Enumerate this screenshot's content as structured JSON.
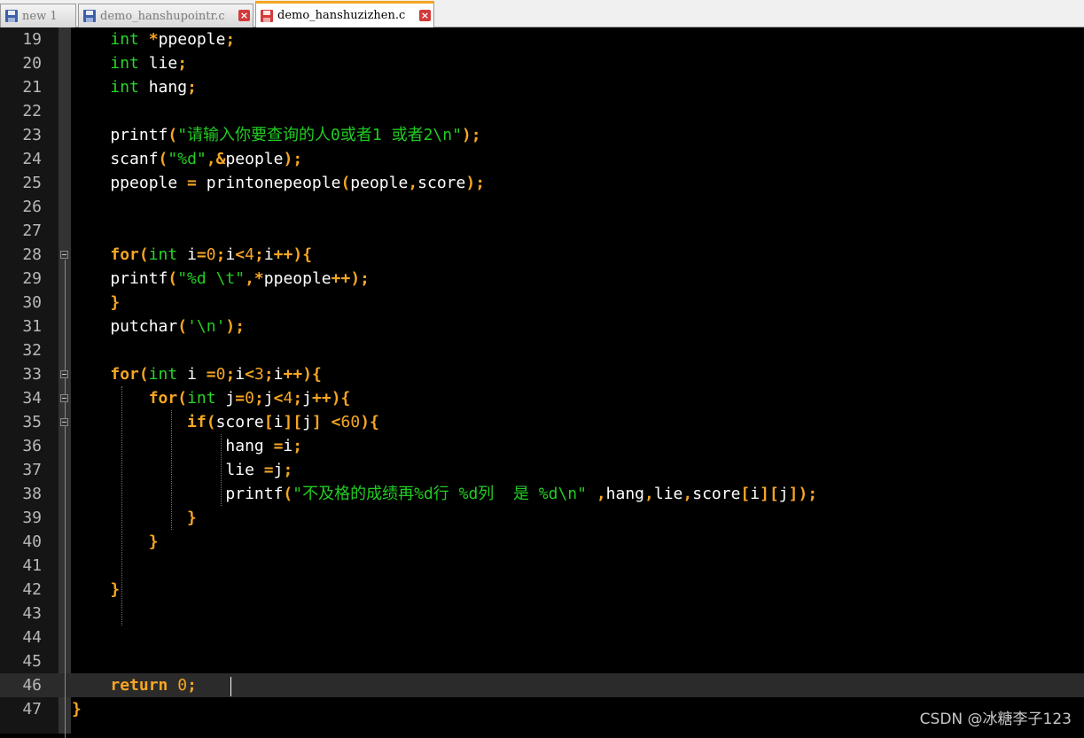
{
  "tabs": [
    {
      "label": "new 1",
      "icon": "floppy-disk-icon",
      "active": false
    },
    {
      "label": "demo_hanshupointr.c",
      "icon": "floppy-disk-icon",
      "active": false
    },
    {
      "label": "demo_hanshuzizhen.c",
      "icon": "floppy-disk-red-icon",
      "active": true
    }
  ],
  "colors": {
    "keyword": "#f5a623",
    "type": "#27d627",
    "string": "#22cc22",
    "number": "#f5a623",
    "text": "#ffffff",
    "background": "#000000",
    "gutter": "#151515",
    "current_line": "#2b2b2b",
    "tab_accent": "#f5a623"
  },
  "editor": {
    "current_line": 46,
    "lines": [
      {
        "num": "19",
        "tokens": [
          [
            "    ",
            ""
          ],
          [
            "int",
            "ty"
          ],
          [
            " ",
            ""
          ],
          [
            "*",
            "op"
          ],
          [
            "ppeople",
            ""
          ],
          [
            ";",
            "op"
          ]
        ]
      },
      {
        "num": "20",
        "tokens": [
          [
            "    ",
            ""
          ],
          [
            "int",
            "ty"
          ],
          [
            " lie",
            ""
          ],
          [
            ";",
            "op"
          ]
        ]
      },
      {
        "num": "21",
        "tokens": [
          [
            "    ",
            ""
          ],
          [
            "int",
            "ty"
          ],
          [
            " hang",
            ""
          ],
          [
            ";",
            "op"
          ]
        ]
      },
      {
        "num": "22",
        "tokens": []
      },
      {
        "num": "23",
        "tokens": [
          [
            "    printf",
            ""
          ],
          [
            "(",
            "op"
          ],
          [
            "\"请输入你要查询的人0或者1 或者2\\n\"",
            "str"
          ],
          [
            ")",
            "op"
          ],
          [
            ";",
            "op"
          ]
        ]
      },
      {
        "num": "24",
        "tokens": [
          [
            "    scanf",
            ""
          ],
          [
            "(",
            "op"
          ],
          [
            "\"%d\"",
            "str"
          ],
          [
            ",",
            "op"
          ],
          [
            "&",
            "op"
          ],
          [
            "people",
            ""
          ],
          [
            ")",
            "op"
          ],
          [
            ";",
            "op"
          ]
        ]
      },
      {
        "num": "25",
        "tokens": [
          [
            "    ppeople ",
            ""
          ],
          [
            "=",
            "op"
          ],
          [
            " printonepeople",
            ""
          ],
          [
            "(",
            "op"
          ],
          [
            "people",
            ""
          ],
          [
            ",",
            "op"
          ],
          [
            "score",
            ""
          ],
          [
            ")",
            "op"
          ],
          [
            ";",
            "op"
          ]
        ]
      },
      {
        "num": "26",
        "tokens": []
      },
      {
        "num": "27",
        "tokens": []
      },
      {
        "num": "28",
        "tokens": [
          [
            "    ",
            ""
          ],
          [
            "for",
            "kw"
          ],
          [
            "(",
            "op"
          ],
          [
            "int",
            "ty"
          ],
          [
            " i",
            ""
          ],
          [
            "=",
            "op"
          ],
          [
            "0",
            "num"
          ],
          [
            ";",
            "op"
          ],
          [
            "i",
            ""
          ],
          [
            "<",
            "op"
          ],
          [
            "4",
            "num"
          ],
          [
            ";",
            "op"
          ],
          [
            "i",
            ""
          ],
          [
            "++",
            "op"
          ],
          [
            ")",
            "op"
          ],
          [
            "{",
            "op"
          ]
        ]
      },
      {
        "num": "29",
        "tokens": [
          [
            "    printf",
            ""
          ],
          [
            "(",
            "op"
          ],
          [
            "\"%d \\t\"",
            "str"
          ],
          [
            ",",
            "op"
          ],
          [
            "*",
            "op"
          ],
          [
            "ppeople",
            ""
          ],
          [
            "++",
            "op"
          ],
          [
            ")",
            "op"
          ],
          [
            ";",
            "op"
          ]
        ]
      },
      {
        "num": "30",
        "tokens": [
          [
            "    ",
            ""
          ],
          [
            "}",
            "op"
          ]
        ]
      },
      {
        "num": "31",
        "tokens": [
          [
            "    putchar",
            ""
          ],
          [
            "(",
            "op"
          ],
          [
            "'\\n'",
            "str"
          ],
          [
            ")",
            "op"
          ],
          [
            ";",
            "op"
          ]
        ]
      },
      {
        "num": "32",
        "tokens": []
      },
      {
        "num": "33",
        "tokens": [
          [
            "    ",
            ""
          ],
          [
            "for",
            "kw"
          ],
          [
            "(",
            "op"
          ],
          [
            "int",
            "ty"
          ],
          [
            " i ",
            ""
          ],
          [
            "=",
            "op"
          ],
          [
            "0",
            "num"
          ],
          [
            ";",
            "op"
          ],
          [
            "i",
            ""
          ],
          [
            "<",
            "op"
          ],
          [
            "3",
            "num"
          ],
          [
            ";",
            "op"
          ],
          [
            "i",
            ""
          ],
          [
            "++",
            "op"
          ],
          [
            ")",
            "op"
          ],
          [
            "{",
            "op"
          ]
        ]
      },
      {
        "num": "34",
        "tokens": [
          [
            "        ",
            ""
          ],
          [
            "for",
            "kw"
          ],
          [
            "(",
            "op"
          ],
          [
            "int",
            "ty"
          ],
          [
            " j",
            ""
          ],
          [
            "=",
            "op"
          ],
          [
            "0",
            "num"
          ],
          [
            ";",
            "op"
          ],
          [
            "j",
            ""
          ],
          [
            "<",
            "op"
          ],
          [
            "4",
            "num"
          ],
          [
            ";",
            "op"
          ],
          [
            "j",
            ""
          ],
          [
            "++",
            "op"
          ],
          [
            ")",
            "op"
          ],
          [
            "{",
            "op"
          ]
        ]
      },
      {
        "num": "35",
        "tokens": [
          [
            "            ",
            ""
          ],
          [
            "if",
            "kw"
          ],
          [
            "(",
            "op"
          ],
          [
            "score",
            ""
          ],
          [
            "[",
            "op"
          ],
          [
            "i",
            ""
          ],
          [
            "]",
            "op"
          ],
          [
            "[",
            "op"
          ],
          [
            "j",
            ""
          ],
          [
            "]",
            "op"
          ],
          [
            " ",
            ""
          ],
          [
            "<",
            "op"
          ],
          [
            "60",
            "num"
          ],
          [
            ")",
            "op"
          ],
          [
            "{",
            "op"
          ]
        ]
      },
      {
        "num": "36",
        "tokens": [
          [
            "                hang ",
            ""
          ],
          [
            "=",
            "op"
          ],
          [
            "i",
            ""
          ],
          [
            ";",
            "op"
          ]
        ]
      },
      {
        "num": "37",
        "tokens": [
          [
            "                lie ",
            ""
          ],
          [
            "=",
            "op"
          ],
          [
            "j",
            ""
          ],
          [
            ";",
            "op"
          ]
        ]
      },
      {
        "num": "38",
        "tokens": [
          [
            "                printf",
            ""
          ],
          [
            "(",
            "op"
          ],
          [
            "\"不及格的成绩再%d行 %d列  是 %d\\n\"",
            "str"
          ],
          [
            " ",
            ""
          ],
          [
            ",",
            "op"
          ],
          [
            "hang",
            ""
          ],
          [
            ",",
            "op"
          ],
          [
            "lie",
            ""
          ],
          [
            ",",
            "op"
          ],
          [
            "score",
            ""
          ],
          [
            "[",
            "op"
          ],
          [
            "i",
            ""
          ],
          [
            "]",
            "op"
          ],
          [
            "[",
            "op"
          ],
          [
            "j",
            ""
          ],
          [
            "]",
            "op"
          ],
          [
            ")",
            "op"
          ],
          [
            ";",
            "op"
          ]
        ]
      },
      {
        "num": "39",
        "tokens": [
          [
            "            ",
            ""
          ],
          [
            "}",
            "op"
          ]
        ]
      },
      {
        "num": "40",
        "tokens": [
          [
            "        ",
            ""
          ],
          [
            "}",
            "op"
          ]
        ]
      },
      {
        "num": "41",
        "tokens": []
      },
      {
        "num": "42",
        "tokens": [
          [
            "    ",
            ""
          ],
          [
            "}",
            "op"
          ]
        ]
      },
      {
        "num": "43",
        "tokens": []
      },
      {
        "num": "44",
        "tokens": []
      },
      {
        "num": "45",
        "tokens": []
      },
      {
        "num": "46",
        "tokens": [
          [
            "    ",
            ""
          ],
          [
            "return",
            "kw"
          ],
          [
            " ",
            ""
          ],
          [
            "0",
            "num"
          ],
          [
            ";",
            "op"
          ]
        ]
      },
      {
        "num": "47",
        "tokens": [
          [
            "}",
            "op"
          ]
        ]
      }
    ]
  },
  "watermark": "CSDN @冰糖李子123"
}
